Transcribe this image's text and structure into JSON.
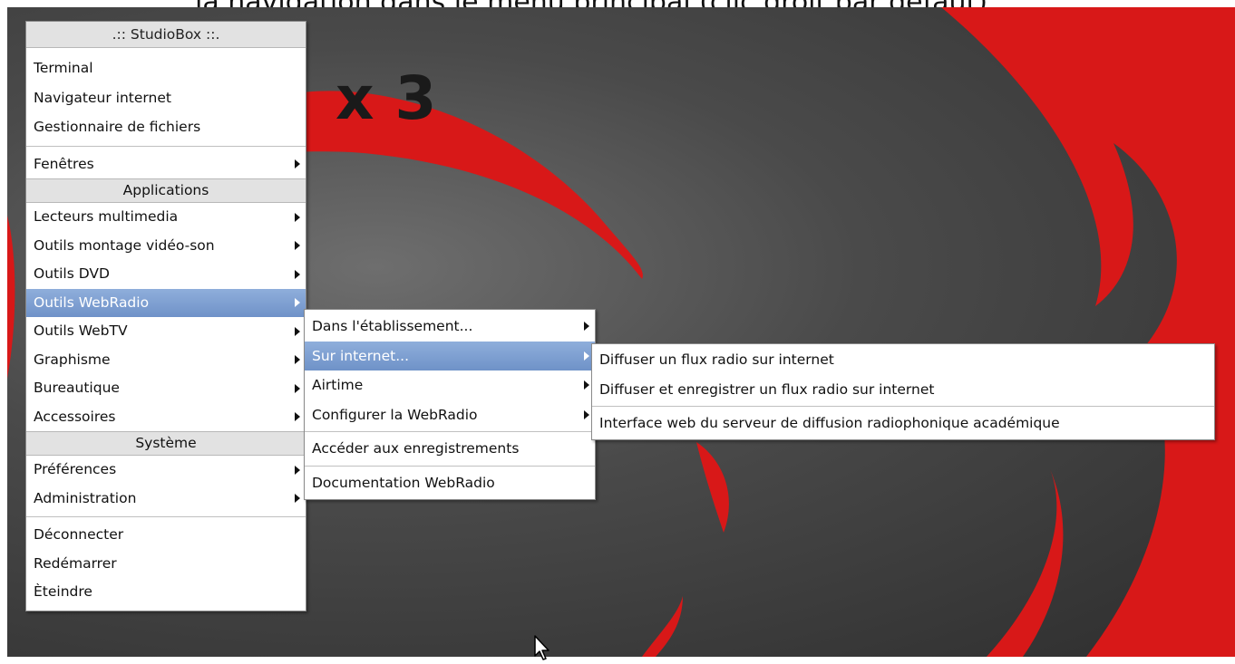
{
  "page_caption": "la navigation dans le menu principal (clic droit par défaut)",
  "wallpaper": {
    "brand_text": "x 3"
  },
  "main_menu": {
    "title": ".:: StudioBox ::.",
    "top_items": [
      {
        "label": "Terminal"
      },
      {
        "label": "Navigateur internet"
      },
      {
        "label": "Gestionnaire de fichiers"
      }
    ],
    "windows_item": {
      "label": "Fenêtres",
      "submenu": true
    },
    "applications_header": "Applications",
    "applications": [
      {
        "label": "Lecteurs multimedia",
        "submenu": true
      },
      {
        "label": "Outils montage vidéo-son",
        "submenu": true
      },
      {
        "label": "Outils DVD",
        "submenu": true
      },
      {
        "label": "Outils WebRadio",
        "submenu": true,
        "selected": true
      },
      {
        "label": "Outils WebTV",
        "submenu": true
      },
      {
        "label": "Graphisme",
        "submenu": true
      },
      {
        "label": "Bureautique",
        "submenu": true
      },
      {
        "label": "Accessoires",
        "submenu": true
      }
    ],
    "system_header": "Système",
    "system": [
      {
        "label": "Préférences",
        "submenu": true
      },
      {
        "label": "Administration",
        "submenu": true
      }
    ],
    "session": [
      {
        "label": "Déconnecter"
      },
      {
        "label": "Redémarrer"
      },
      {
        "label": "Èteindre"
      }
    ]
  },
  "webradio_menu": {
    "items": [
      {
        "label": "Dans l'établissement...",
        "submenu": true
      },
      {
        "label": "Sur internet...",
        "submenu": true,
        "selected": true
      },
      {
        "label": "Airtime",
        "submenu": true
      },
      {
        "label": "Configurer la WebRadio",
        "submenu": true
      }
    ],
    "recordings": "Accéder aux enregistrements",
    "documentation": "Documentation WebRadio"
  },
  "internet_menu": {
    "items": [
      {
        "label": "Diffuser un flux radio sur internet"
      },
      {
        "label": "Diffuser et enregistrer un flux radio sur internet"
      }
    ],
    "interface": "Interface web du serveur de diffusion radiophonique académique"
  },
  "colors": {
    "highlight": "#7a9bd0",
    "wallpaper_red": "#d81818",
    "wallpaper_grey": "#4a4a4a",
    "header_bg": "#e2e2e2"
  }
}
